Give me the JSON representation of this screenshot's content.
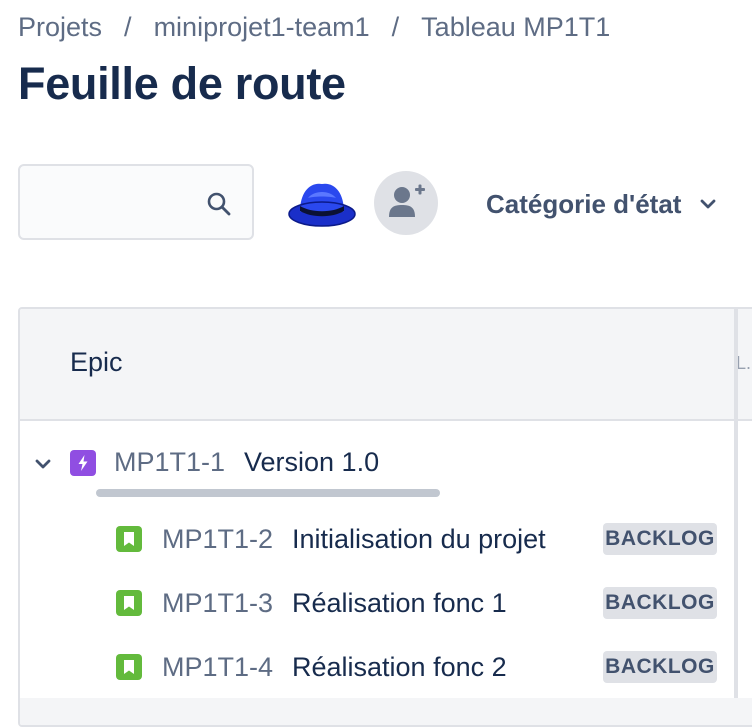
{
  "breadcrumb": {
    "items": [
      "Projets",
      "miniprojet1-team1",
      "Tableau MP1T1"
    ],
    "separator": "/"
  },
  "page": {
    "title": "Feuille de route"
  },
  "search": {
    "placeholder": "",
    "value": ""
  },
  "filters": {
    "status_category_label": "Catégorie d'état"
  },
  "table": {
    "columns": [
      "Epic",
      "L."
    ],
    "epic": {
      "key": "MP1T1-1",
      "summary": "Version 1.0",
      "expanded": true,
      "icon": "epic-lightning-icon"
    },
    "issues": [
      {
        "key": "MP1T1-2",
        "summary": "Initialisation du projet",
        "status": "BACKLOG",
        "icon": "story-bookmark-icon"
      },
      {
        "key": "MP1T1-3",
        "summary": "Réalisation fonc 1",
        "status": "BACKLOG",
        "icon": "story-bookmark-icon"
      },
      {
        "key": "MP1T1-4",
        "summary": "Réalisation fonc 2",
        "status": "BACKLOG",
        "icon": "story-bookmark-icon"
      }
    ]
  },
  "colors": {
    "epic": "#904ee2",
    "story": "#63ba3c",
    "badge_bg": "#dfe1e6",
    "text": "#172b4d"
  }
}
